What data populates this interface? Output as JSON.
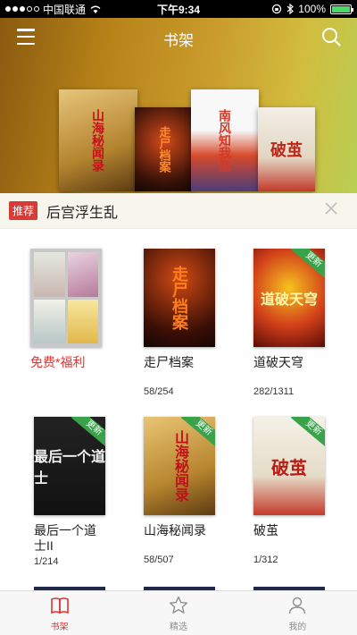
{
  "status_bar": {
    "carrier": "中国联通",
    "time": "下午9:34",
    "battery": "100%"
  },
  "header": {
    "title": "书架",
    "menu_icon": "hamburger-menu-icon",
    "search_icon": "search-icon"
  },
  "hero": {
    "books": [
      {
        "title": "山海秘闻录"
      },
      {
        "title": "走尸档案"
      },
      {
        "title": "南风知我意"
      },
      {
        "title": "破茧"
      }
    ]
  },
  "recommendation": {
    "badge": "推荐",
    "title": "后宫浮生乱"
  },
  "books": [
    {
      "title": "免费*福利",
      "progress": "",
      "highlight": true,
      "updated": false
    },
    {
      "title": "走尸档案",
      "progress": "58/254",
      "highlight": false,
      "updated": false
    },
    {
      "title": "道破天穹",
      "progress": "282/1311",
      "highlight": false,
      "updated": true
    },
    {
      "title": "最后一个道士II",
      "progress": "1/214",
      "highlight": false,
      "updated": true
    },
    {
      "title": "山海秘闻录",
      "progress": "58/507",
      "highlight": false,
      "updated": true
    },
    {
      "title": "破茧",
      "progress": "1/312",
      "highlight": false,
      "updated": true
    }
  ],
  "cover_text": {
    "zsdq": "走尸档案",
    "dptq": "道破天穹",
    "zhyg": "最后一个道士",
    "shmw": "山海秘闻录",
    "pj": "破茧"
  },
  "ribbon_label": "更新",
  "tabs": [
    {
      "label": "书架",
      "icon": "book-icon",
      "active": true
    },
    {
      "label": "精选",
      "icon": "star-icon",
      "active": false
    },
    {
      "label": "我的",
      "icon": "person-icon",
      "active": false
    }
  ],
  "colors": {
    "accent": "#e3312f",
    "update_ribbon": "#39a24a"
  }
}
